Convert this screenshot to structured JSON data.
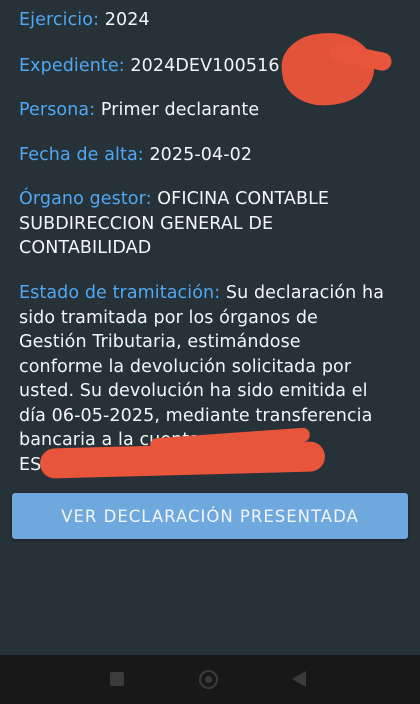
{
  "fields": {
    "ejercicio": {
      "label": "Ejercicio:",
      "value": "2024"
    },
    "expediente": {
      "label": "Expediente:",
      "value": "2024DEV100516"
    },
    "persona": {
      "label": "Persona:",
      "value": "Primer declarante"
    },
    "fecha_alta": {
      "label": "Fecha de alta:",
      "value": "2025-04-02"
    },
    "organo_gestor": {
      "label": "Órgano gestor:",
      "value": "OFICINA CONTABLE SUBDIRECCION GENERAL DE CONTABILIDAD"
    },
    "estado_tramitacion": {
      "label": "Estado de tramitación:",
      "value": "Su declaración ha sido tramitada por los órganos de Gestión Tributaria, estimándose conforme la devolución solicitada por usted. Su devolución ha sido emitida el día 06-05-2025, mediante transferencia bancaria a la cuenta con IBAN:",
      "iban_prefix": "ES"
    }
  },
  "button": {
    "label": "VER DECLARACIÓN PRESENTADA"
  },
  "navbar": {
    "icons": [
      "recents-icon",
      "home-icon",
      "back-icon"
    ]
  },
  "colors": {
    "background": "#263238",
    "label": "#52a7f2",
    "text": "#f4f6f8",
    "button": "#6ea8dc",
    "redaction": "#e8553a",
    "navbar": "#181818"
  }
}
